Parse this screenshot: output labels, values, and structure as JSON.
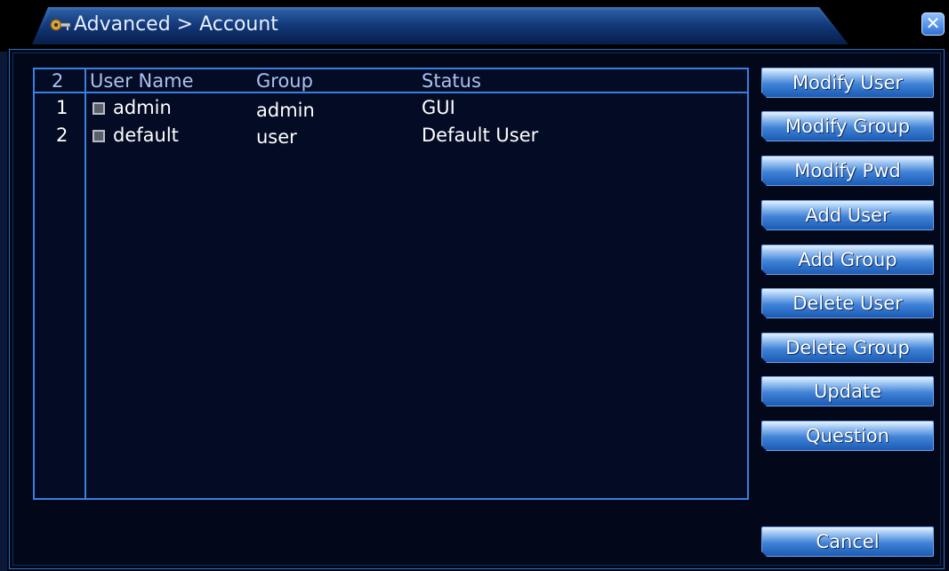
{
  "window": {
    "title": "Advanced > Account",
    "close_icon": "close-icon",
    "title_icon": "keys-icon"
  },
  "list": {
    "count": "2",
    "headers": [
      "User Name",
      "Group",
      "Status"
    ],
    "rows": [
      {
        "index": "1",
        "user": "admin",
        "group": "admin",
        "status": "GUI"
      },
      {
        "index": "2",
        "user": "default",
        "group": "user",
        "status": "Default User"
      }
    ]
  },
  "buttons": {
    "modify_user": "Modify User",
    "modify_group": "Modify Group",
    "modify_pwd": "Modify Pwd",
    "add_user": "Add User",
    "add_group": "Add Group",
    "delete_user": "Delete User",
    "delete_group": "Delete Group",
    "update": "Update",
    "question": "Question",
    "cancel": "Cancel"
  },
  "colors": {
    "accent": "#3b7fe0",
    "background": "#020819",
    "button": "#3f82d6"
  }
}
